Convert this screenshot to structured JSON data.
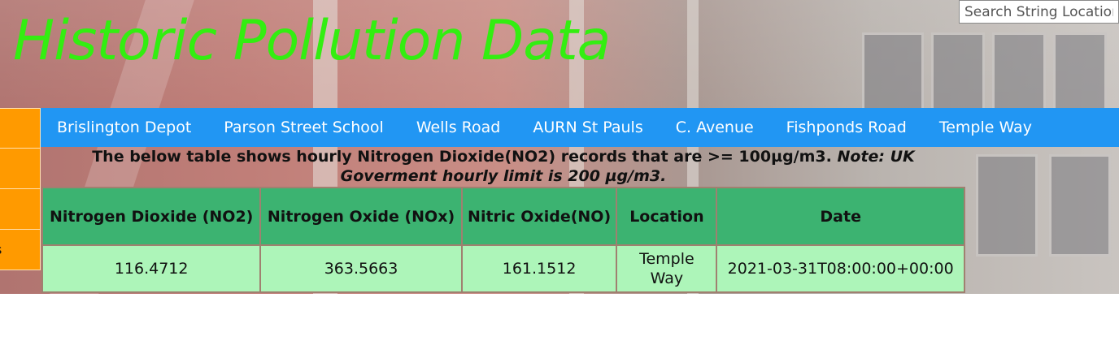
{
  "page": {
    "title": "Historic Pollution Data"
  },
  "search": {
    "placeholder": "Search String Location"
  },
  "sidebar": {
    "items": [
      {
        "label": ""
      },
      {
        "label": ""
      },
      {
        "label": ""
      },
      {
        "label": "s"
      }
    ]
  },
  "nav": {
    "items": [
      {
        "label": "Brislington Depot"
      },
      {
        "label": "Parson Street School"
      },
      {
        "label": "Wells Road"
      },
      {
        "label": "AURN St Pauls"
      },
      {
        "label": "C. Avenue"
      },
      {
        "label": "Fishponds Road"
      },
      {
        "label": "Temple Way"
      }
    ]
  },
  "intro": {
    "text": "The below table shows hourly Nitrogen Dioxide(NO2) records that are >= 100µg/m3.",
    "note": "Note: UK Goverment hourly limit is 200 µg/m3."
  },
  "table": {
    "headers": [
      "Nitrogen Dioxide (NO2)",
      "Nitrogen Oxide (NOx)",
      "Nitric Oxide(NO)",
      "Location",
      "Date"
    ],
    "rows": [
      [
        "116.4712",
        "363.5663",
        "161.1512",
        "Temple Way",
        "2021-03-31T08:00:00+00:00"
      ]
    ]
  },
  "colors": {
    "title": "#33ee11",
    "nav_bg": "#2196f3",
    "sidebar_bg": "#ff9a00",
    "table_header_bg": "#3cb371",
    "table_cell_bg": "#adf5b9"
  }
}
